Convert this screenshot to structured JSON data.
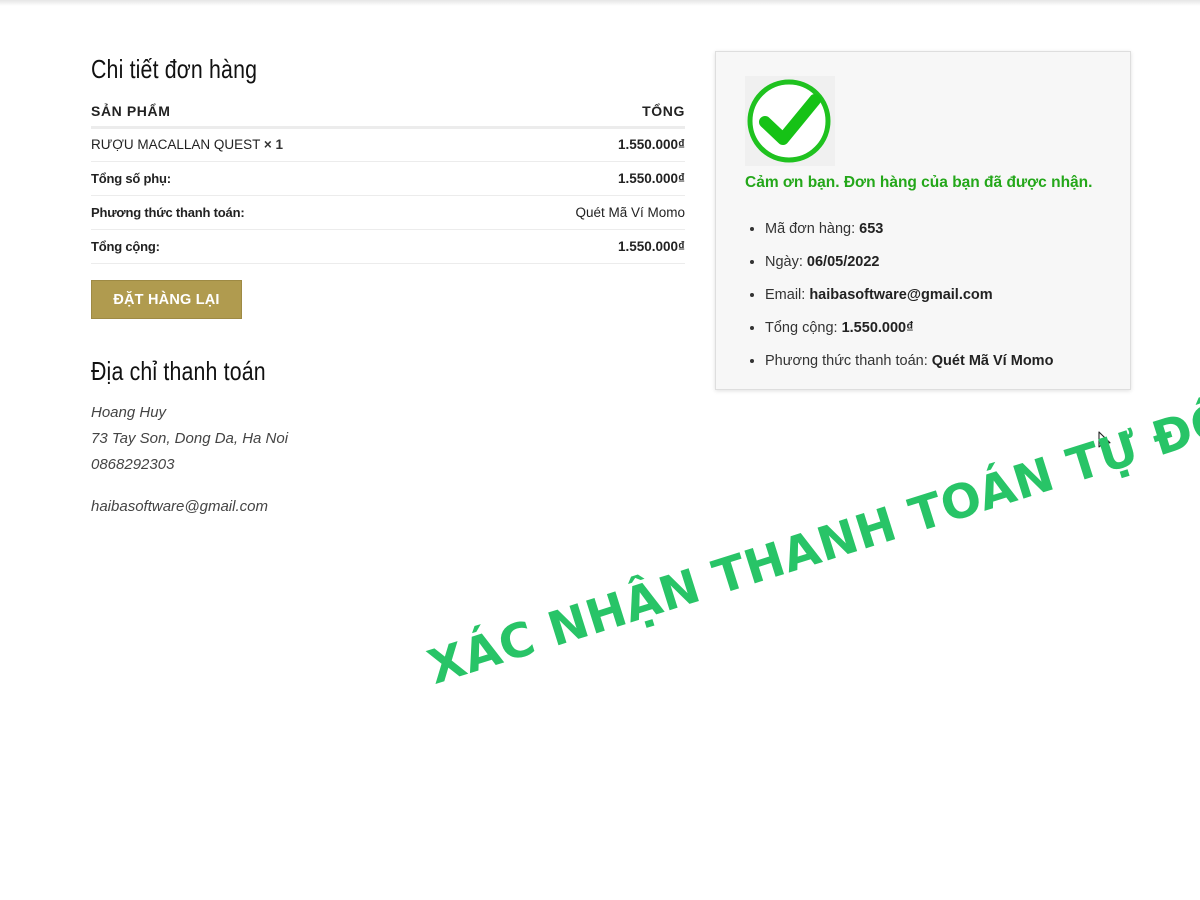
{
  "order_details": {
    "title": "Chi tiết đơn hàng",
    "col_product": "SẢN PHẨM",
    "col_total": "TỔNG",
    "product_name": "RƯỢU MACALLAN QUEST",
    "product_qty": "× 1",
    "product_total": "1.550.000₫",
    "subtotal_label": "Tổng số phụ:",
    "subtotal_value": "1.550.000₫",
    "payment_label": "Phương thức thanh toán:",
    "payment_value": "Quét Mã Ví Momo",
    "total_label": "Tổng cộng:",
    "total_value": "1.550.000₫",
    "order_again_label": "ĐẶT HÀNG LẠI"
  },
  "billing": {
    "title": "Địa chỉ thanh toán",
    "name": "Hoang Huy",
    "address": "73 Tay Son, Dong Da, Ha Noi",
    "phone": "0868292303",
    "email": "haibasoftware@gmail.com"
  },
  "confirmation": {
    "message": "Cảm ơn bạn. Đơn hàng của bạn đã được nhận.",
    "order_number_label": "Mã đơn hàng:",
    "order_number": "653",
    "date_label": "Ngày:",
    "date": "06/05/2022",
    "email_label": "Email:",
    "email": "haibasoftware@gmail.com",
    "total_label": "Tổng cộng:",
    "total": "1.550.000₫",
    "payment_label": "Phương thức thanh toán:",
    "payment": "Quét Mã Ví Momo"
  },
  "overlay": {
    "watermark": "XÁC NHẬN THANH TOÁN TỰ ĐỘNG"
  },
  "colors": {
    "button": "#b09b4f",
    "success": "#24a71a",
    "watermark": "#28c467"
  },
  "icons": [
    "check-circle-icon",
    "mouse-cursor-icon"
  ]
}
